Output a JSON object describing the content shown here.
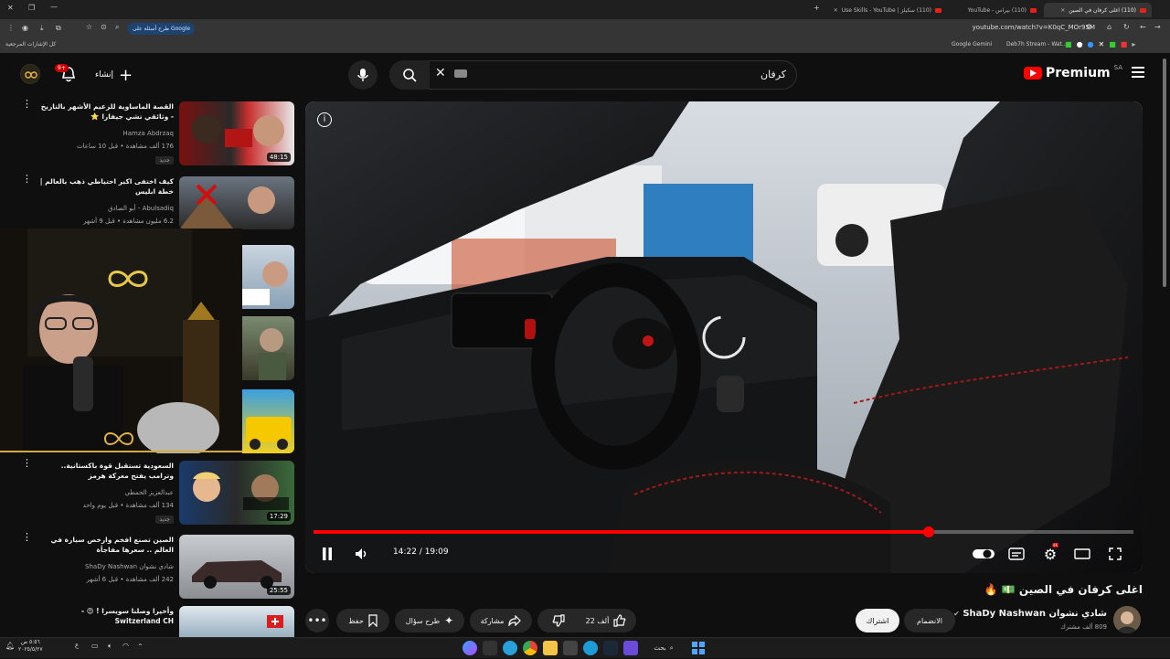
{
  "browser": {
    "tabs": [
      {
        "title": "(110) اغلى كرفان في الصين",
        "active": true
      },
      {
        "title": "(110) بيراس - YouTube",
        "active": false
      },
      {
        "title": "(110) سكيلز | Use Skills - YouTube",
        "active": false
      }
    ],
    "url": "youtube.com/watch?v=K0qC_MOr95M",
    "google_button": "طرح أسئلة على Google",
    "bookmarks_label": "كل الإشارات المرجعية",
    "bookmark_items": [
      "Google Gemini",
      "Deb7h Stream - Wat..."
    ]
  },
  "header": {
    "search_query": "كرفان",
    "logo_text": "Premium",
    "region": "SA",
    "create_label": "إنشاء",
    "notif_count": "9+"
  },
  "player": {
    "time": "14:22 / 19:09",
    "progress": 0.75
  },
  "video": {
    "title": "اغلى كرفان في الصين 💵 🔥",
    "channel_name": "شادي نشوان ShaDy Nashwan",
    "subscribers": "809 ألف مشترك",
    "join_label": "الانضمام",
    "subscribe_label": "اشتراك",
    "likes": "22 ألف",
    "share_label": "مشاركة",
    "ask_label": "طرح سؤال",
    "save_label": "حفظ"
  },
  "sidebar": [
    {
      "title": "القصة الماساوية للزعيم الأشهر بالتاريخ - وثائقي تشي جيفارا ⭐",
      "channel": "Hamza Abdrzaq",
      "meta": "176 ألف مشاهدة • قبل 10 ساعات",
      "duration": "48:15",
      "new": "جديد"
    },
    {
      "title": "كيف اختفى اكبر احتياطي ذهب بالعالم | خطة ابليس",
      "channel": "Abulsadiq - أبو الصادق",
      "meta": "6.2 مليون مشاهدة • قبل 9 أشهر",
      "duration": "",
      "new": ""
    },
    {
      "title": "السعودية تستقبل قوة باكستانية.. وترامب يفتح معركة هرمز",
      "channel": "عبدالعزيز الحمطي",
      "meta": "134 ألف مشاهدة • قبل يوم واحد",
      "duration": "17:29",
      "new": "جديد"
    },
    {
      "title": "الصين تصنع افخم وارخص سيارة في العالم .. سعرها مفاجأة",
      "channel": "شادي نشوان ShaDy Nashwan",
      "meta": "242 ألف مشاهدة • قبل 6 أشهر",
      "duration": "25:55",
      "new": ""
    },
    {
      "title": "وأخيرا وصلنا سويسرا ! 😍 - Switzerland CH",
      "channel": "",
      "meta": "",
      "duration": "",
      "new": ""
    }
  ],
  "taskbar": {
    "search_label": "بحث",
    "time": "٥:٥٦ ص",
    "date": "٢٠٢٥/٥/٢٧"
  }
}
